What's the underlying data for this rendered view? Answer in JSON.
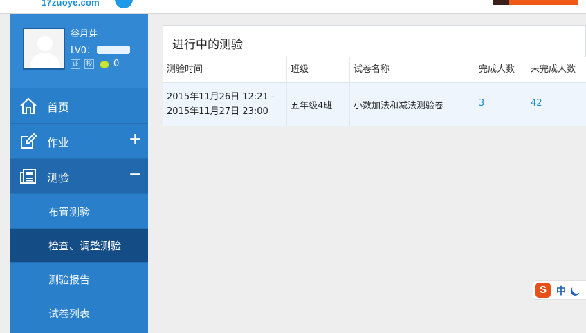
{
  "header": {
    "logo_text": "17zuoye.com"
  },
  "profile": {
    "name": "谷月芽",
    "level": "LV0：",
    "badges": [
      "证",
      "校"
    ],
    "coins": "0"
  },
  "nav": {
    "home": "首页",
    "homework": "作业",
    "homework_sign": "+",
    "test": "测验",
    "test_sign": "−",
    "sub_items": [
      "布置测验",
      "检查、调整测验",
      "测验报告",
      "试卷列表"
    ]
  },
  "panel": {
    "title": "进行中的测验",
    "columns": [
      "测验时间",
      "班级",
      "试卷名称",
      "完成人数",
      "未完成人数"
    ],
    "rows": [
      {
        "time_start": "2015年11月26日 12:21 -",
        "time_end": "2015年11月27日 23:00",
        "class": "五年级4班",
        "paper": "小数加法和减法测验卷",
        "completed": "3",
        "uncompleted": "42"
      }
    ]
  },
  "ime": {
    "logo": "S",
    "mode": "中"
  },
  "colors": {
    "sidebar": "#2a7fcb",
    "sidebar_active": "#144c86",
    "link": "#1f8bd3",
    "brand_orange": "#f05a16"
  }
}
